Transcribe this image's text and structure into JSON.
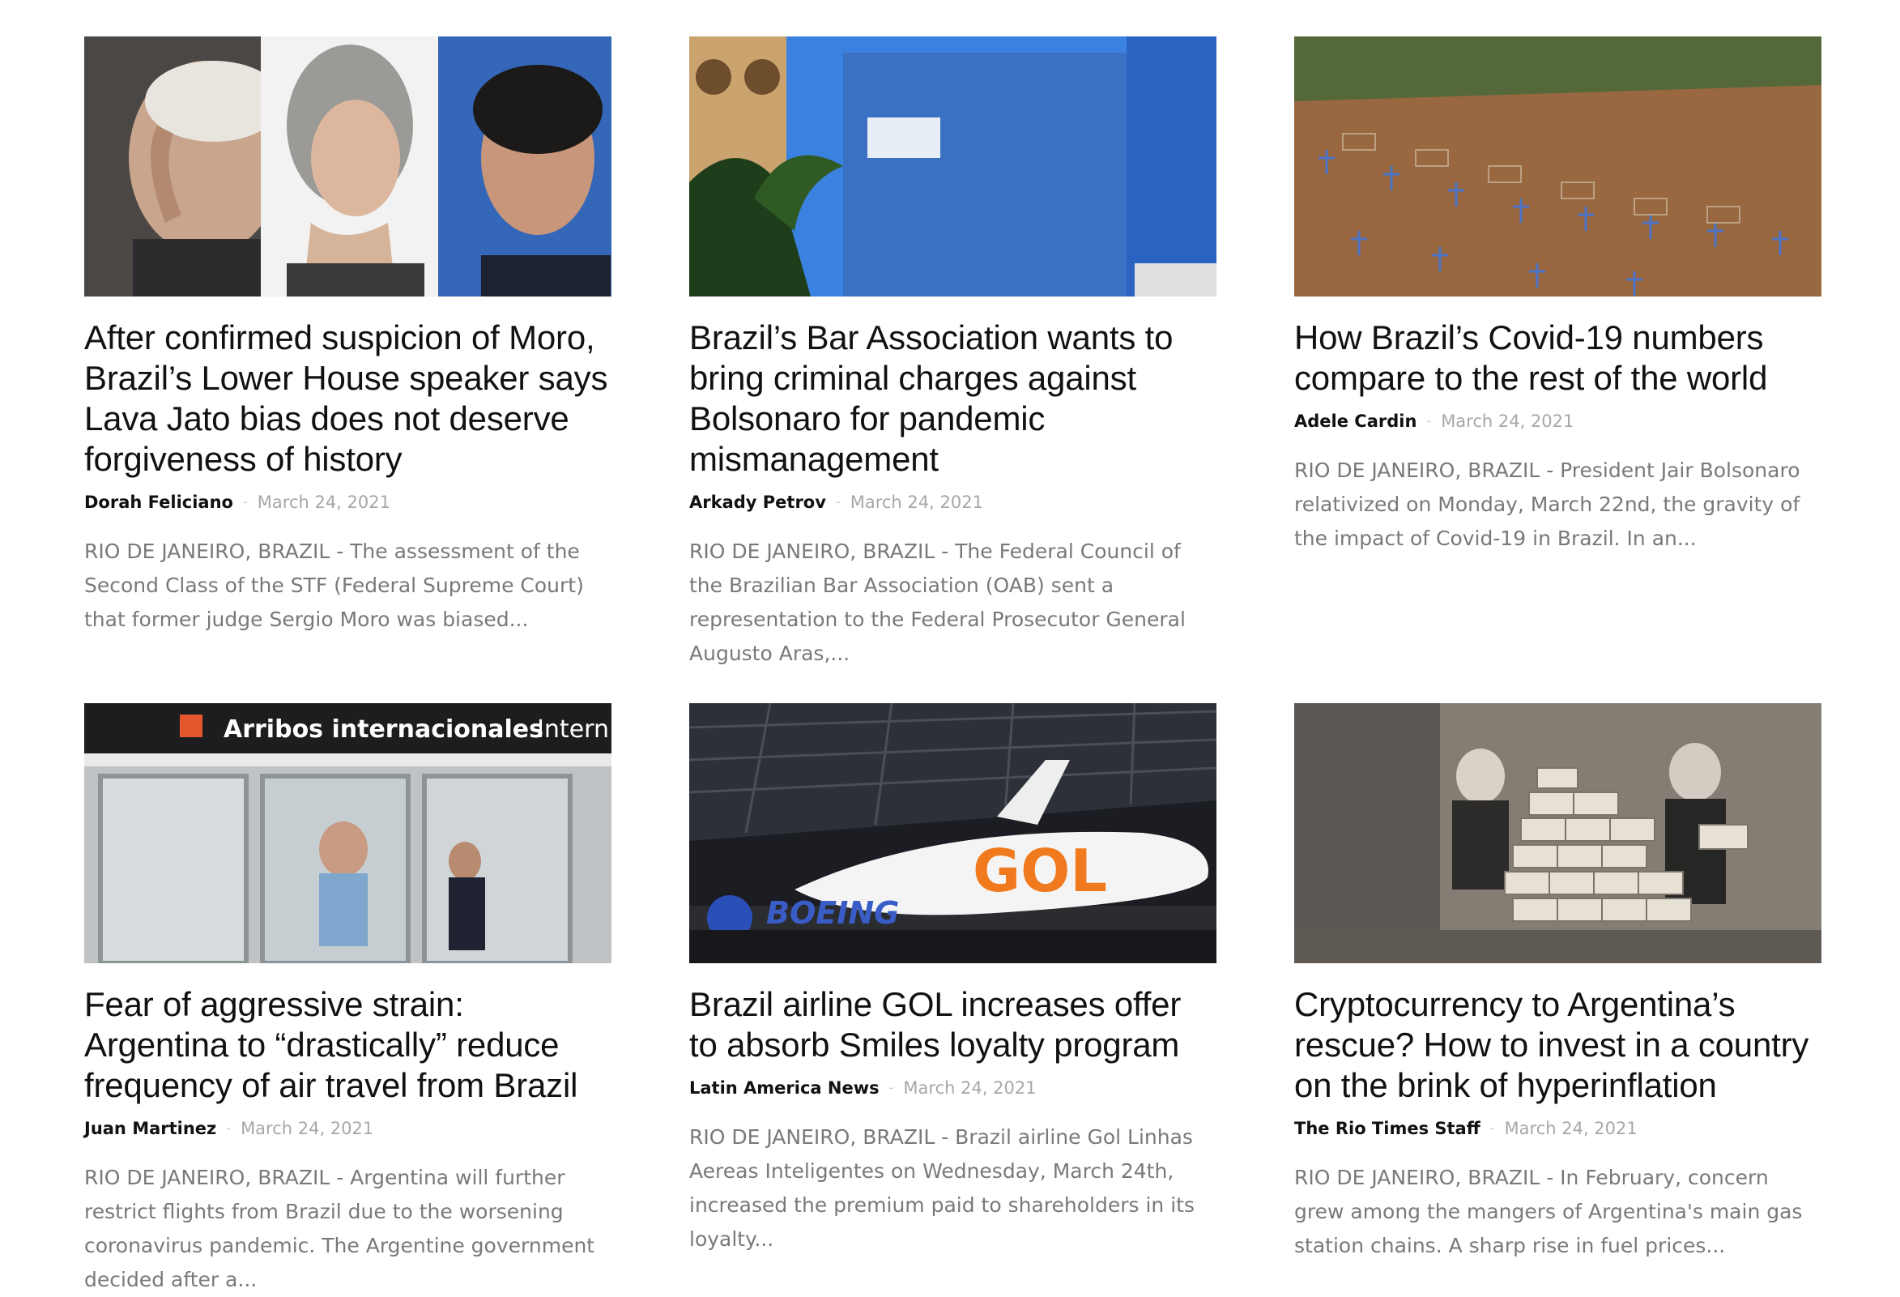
{
  "articles": [
    {
      "title": "After confirmed suspicion of Moro, Brazil’s Lower House speaker says Lava Jato bias does not deserve forgiveness of history",
      "author": "Dorah Feliciano",
      "separator": "-",
      "date": "March 24, 2021",
      "excerpt": "RIO DE JANEIRO, BRAZIL - The assessment of the Second Class of the STF (Federal Supreme Court) that former judge Sergio Moro was biased..."
    },
    {
      "title": "Brazil’s Bar Association wants to bring criminal charges against Bolsonaro for pandemic mismanagement",
      "author": "Arkady Petrov",
      "separator": "-",
      "date": "March 24, 2021",
      "excerpt": "RIO DE JANEIRO, BRAZIL - The Federal Council of the Brazilian Bar Association (OAB) sent a representation to the Federal Prosecutor General Augusto Aras,..."
    },
    {
      "title": "How Brazil’s Covid-19 numbers compare to the rest of the world",
      "author": "Adele Cardin",
      "separator": "-",
      "date": "March 24, 2021",
      "excerpt": "RIO DE JANEIRO, BRAZIL - President Jair Bolsonaro relativized on Monday, March 22nd, the gravity of the impact of Covid-19 in Brazil. In an..."
    },
    {
      "title": "Fear of aggressive strain: Argentina to “drastically” reduce frequency of air travel from Brazil",
      "author": "Juan Martinez",
      "separator": "-",
      "date": "March 24, 2021",
      "excerpt": "RIO DE JANEIRO, BRAZIL - Argentina will further restrict flights from Brazil due to the worsening coronavirus pandemic. The Argentine government decided after a...",
      "image_text": {
        "sign": "Arribos internacionales",
        "sign_extra": "· Intern"
      }
    },
    {
      "title": "Brazil airline GOL increases offer to absorb Smiles loyalty program",
      "author": "Latin America News",
      "separator": "-",
      "date": "March 24, 2021",
      "excerpt": "RIO DE JANEIRO, BRAZIL - Brazil airline Gol Linhas Aereas Inteligentes on Wednesday, March 24th, increased the premium paid to shareholders in its loyalty...",
      "image_text": {
        "plane_logo": "GOL",
        "boeing": "BOEING"
      }
    },
    {
      "title": "Cryptocurrency to Argentina’s rescue? How to invest in a country on the brink of hyperinflation",
      "author": "The Rio Times Staff",
      "separator": "-",
      "date": "March 24, 2021",
      "excerpt": "RIO DE JANEIRO, BRAZIL - In February, concern grew among the mangers of Argentina's main gas station chains. A sharp rise in fuel prices..."
    }
  ]
}
